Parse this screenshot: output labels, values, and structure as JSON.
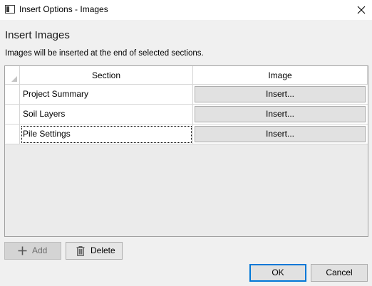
{
  "window": {
    "title": "Insert Options - Images"
  },
  "heading": "Insert Images",
  "description": "Images will be inserted at the end of selected sections.",
  "grid": {
    "columns": [
      "Section",
      "Image"
    ],
    "rows": [
      {
        "section": "Project Summary",
        "button": "Insert..."
      },
      {
        "section": "Soil Layers",
        "button": "Insert..."
      },
      {
        "section": "Pile Settings",
        "button": "Insert..."
      }
    ],
    "focused_row": 2
  },
  "toolbar": {
    "add_label": "Add",
    "add_enabled": false,
    "delete_label": "Delete",
    "add_icon": "plus-icon",
    "delete_icon": "trash-icon"
  },
  "dialog": {
    "ok_label": "OK",
    "cancel_label": "Cancel"
  },
  "colors": {
    "accent": "#0078d7",
    "button_face": "#e1e1e1",
    "grid_background": "#ebebeb"
  }
}
